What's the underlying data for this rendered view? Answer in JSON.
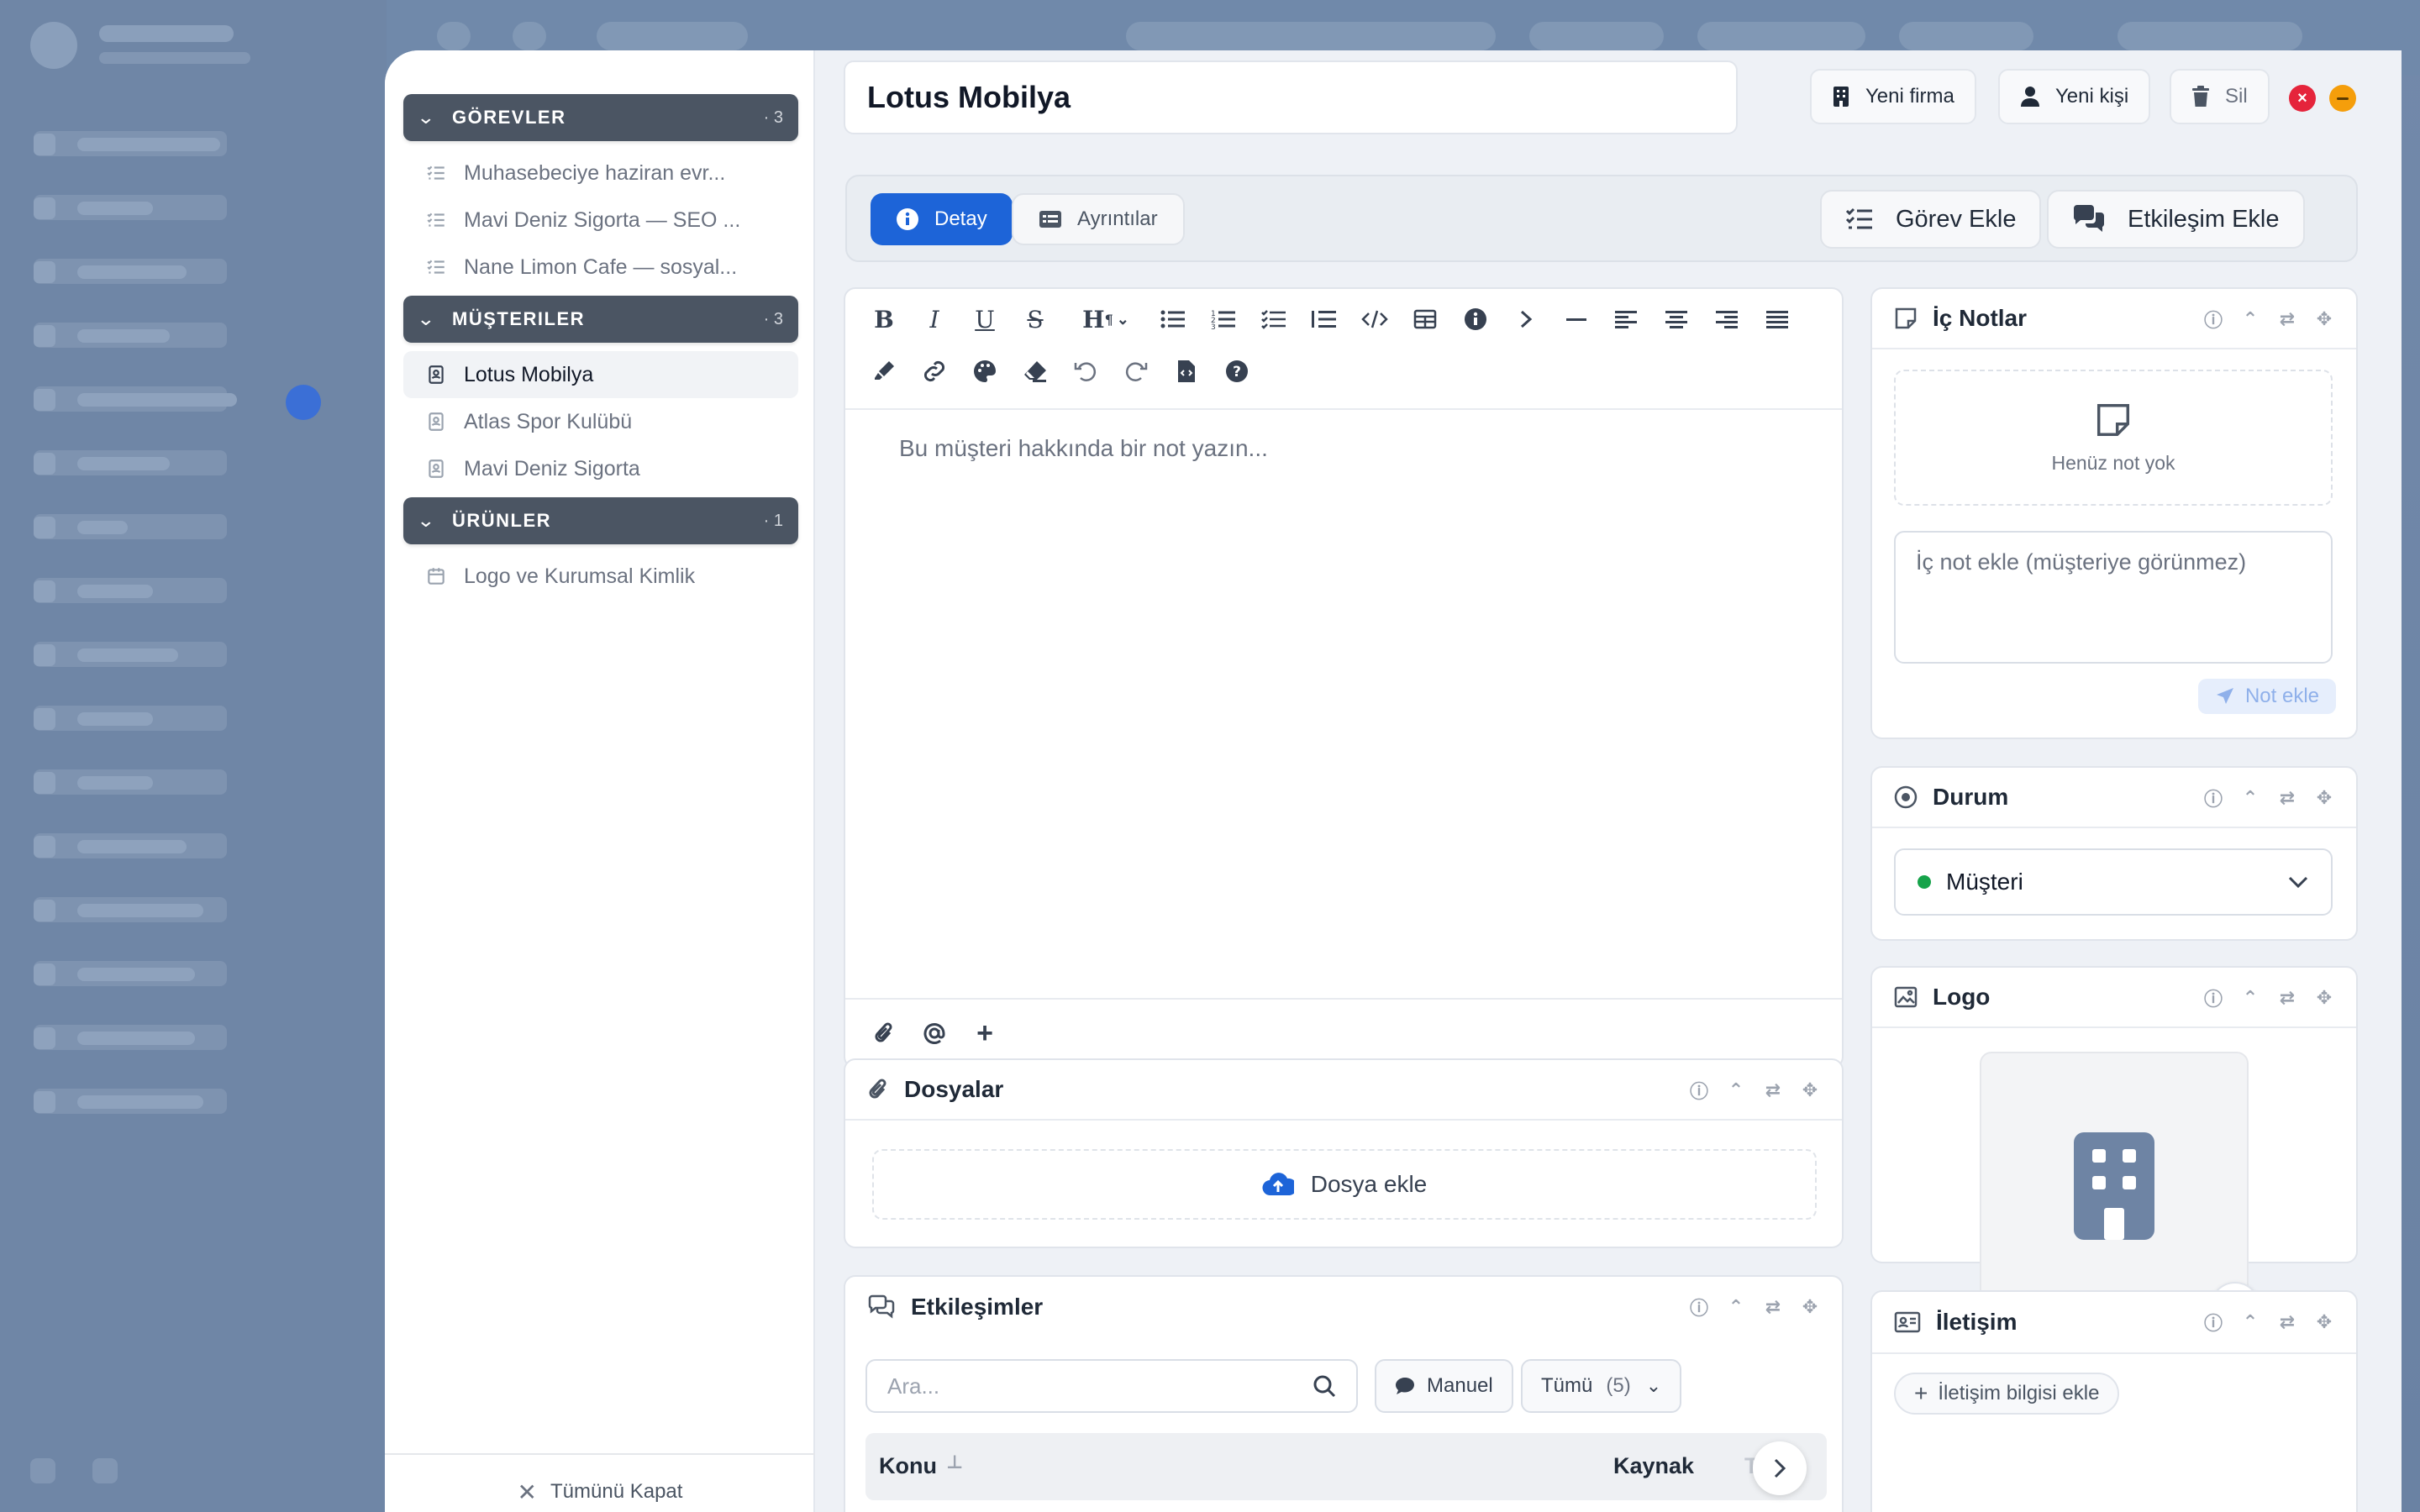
{
  "left_panel": {
    "groups": [
      {
        "title": "GÖREVLER",
        "count": "· 3",
        "items": [
          "Muhasebeciye haziran evr...",
          "Mavi Deniz Sigorta — SEO ...",
          "Nane Limon Cafe — sosyal..."
        ]
      },
      {
        "title": "MÜŞTERILER",
        "count": "· 3",
        "items": [
          "Lotus Mobilya",
          "Atlas Spor Kulübü",
          "Mavi Deniz Sigorta"
        ]
      },
      {
        "title": "ÜRÜNLER",
        "count": "· 1",
        "items": [
          "Logo ve Kurumsal Kimlik"
        ]
      }
    ],
    "close_all": "Tümünü Kapat"
  },
  "header": {
    "title": "Lotus Mobilya",
    "new_company": "Yeni firma",
    "new_person": "Yeni kişi",
    "delete": "Sil"
  },
  "tabs": {
    "detail": "Detay",
    "details": "Ayrıntılar",
    "add_task": "Görev Ekle",
    "add_interaction": "Etkileşim Ekle"
  },
  "editor": {
    "placeholder": "Bu müşteri hakkında bir not yazın..."
  },
  "files": {
    "title": "Dosyalar",
    "add": "Dosya ekle"
  },
  "interactions": {
    "title": "Etkileşimler",
    "search_placeholder": "Ara...",
    "manual": "Manuel",
    "filter": "Tümü",
    "filter_count": "(5)",
    "col_subject": "Konu",
    "col_source": "Kaynak",
    "col_date": "Tar"
  },
  "notes": {
    "title": "İç Notlar",
    "empty": "Henüz not yok",
    "input_placeholder": "İç not ekle (müşteriye görünmez)",
    "add": "Not ekle"
  },
  "status": {
    "title": "Durum",
    "value": "Müşteri",
    "color": "#16a34a"
  },
  "logo": {
    "title": "Logo"
  },
  "contact": {
    "title": "İletişim",
    "add": "İletişim bilgisi ekle"
  },
  "colors": {
    "primary": "#1d64d8",
    "group_header": "#4b5563",
    "close": "#e5243b",
    "minimize": "#f59e0b"
  }
}
